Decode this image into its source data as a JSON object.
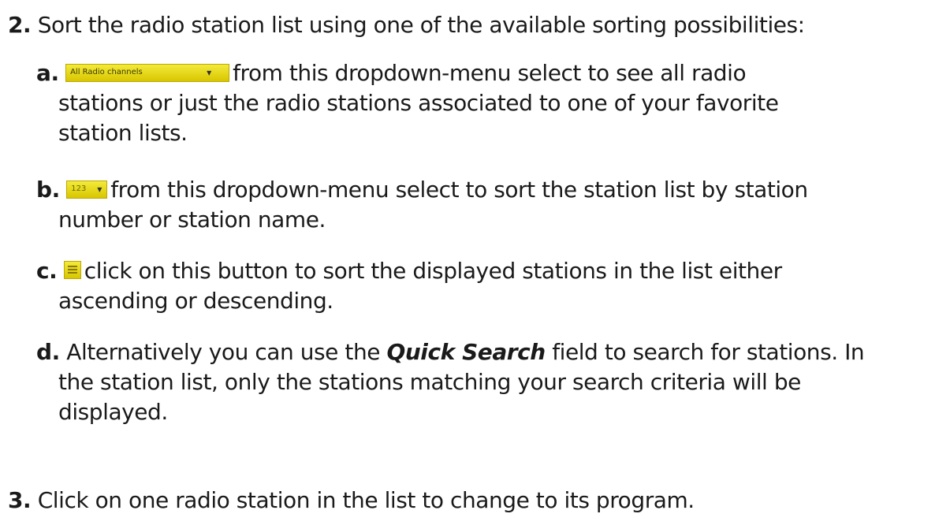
{
  "step2": {
    "number": "2.",
    "text": "Sort the radio station list using one of the available sorting possibilities:"
  },
  "items": {
    "a": {
      "letter": "a.",
      "widget_label": "All Radio channels",
      "line1": "from this dropdown-menu select to see all radio",
      "line2": "stations or just the radio stations associated to one of your favorite",
      "line3": "station lists."
    },
    "b": {
      "letter": "b.",
      "widget_label": "123",
      "line1": "from this dropdown-menu select to sort the station list by station",
      "line2": "number or station name."
    },
    "c": {
      "letter": "c.",
      "line1": "click on this button to sort the displayed stations in the list either",
      "line2": "ascending or descending."
    },
    "d": {
      "letter": "d.",
      "line1_pre": "Alternatively you can use the",
      "line1_emph": "Quick Search",
      "line1_post": "field to search for stations. In",
      "line2": "the station list, only the stations matching your search criteria will be",
      "line3": "displayed."
    }
  },
  "step3": {
    "number": "3.",
    "text": "Click on one radio station in the list to change to its program."
  },
  "colors": {
    "widget_yellow": "#e8dc1a",
    "text": "#1a1a1a"
  },
  "icons": {
    "dropdown_caret": "chevron-down-icon",
    "sort_button": "sort-order-icon"
  }
}
